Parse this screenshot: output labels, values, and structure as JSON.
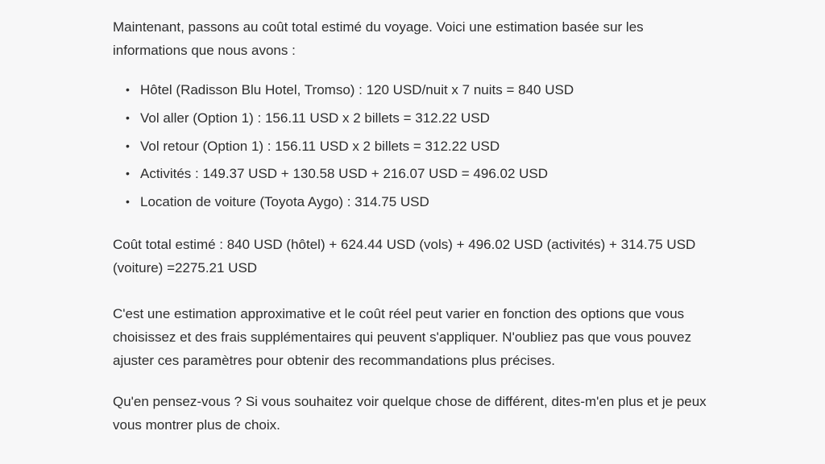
{
  "intro": "Maintenant, passons au coût total estimé du voyage. Voici une estimation basée sur les informations que nous avons :",
  "items": [
    "Hôtel (Radisson Blu Hotel, Tromso) : 120 USD/nuit x 7 nuits = 840 USD",
    "Vol aller (Option 1) : 156.11 USD x 2 billets = 312.22 USD",
    "Vol retour (Option 1) : 156.11 USD x 2 billets = 312.22 USD",
    "Activités : 149.37 USD + 130.58 USD + 216.07 USD = 496.02 USD",
    "Location de voiture (Toyota Aygo) : 314.75 USD"
  ],
  "total": "Coût total estimé : 840 USD (hôtel) + 624.44 USD (vols) + 496.02 USD (activités) + 314.75 USD (voiture) =2275.21 USD",
  "disclaimer": "C'est une estimation approximative et le coût réel peut varier en fonction des options que vous choisissez et des frais supplémentaires qui peuvent s'appliquer. N'oubliez pas que vous pouvez ajuster ces paramètres pour obtenir des recommandations plus précises.",
  "closing": "Qu'en pensez-vous ? Si vous souhaitez voir quelque chose de différent, dites-m'en plus et je peux vous montrer plus de choix."
}
